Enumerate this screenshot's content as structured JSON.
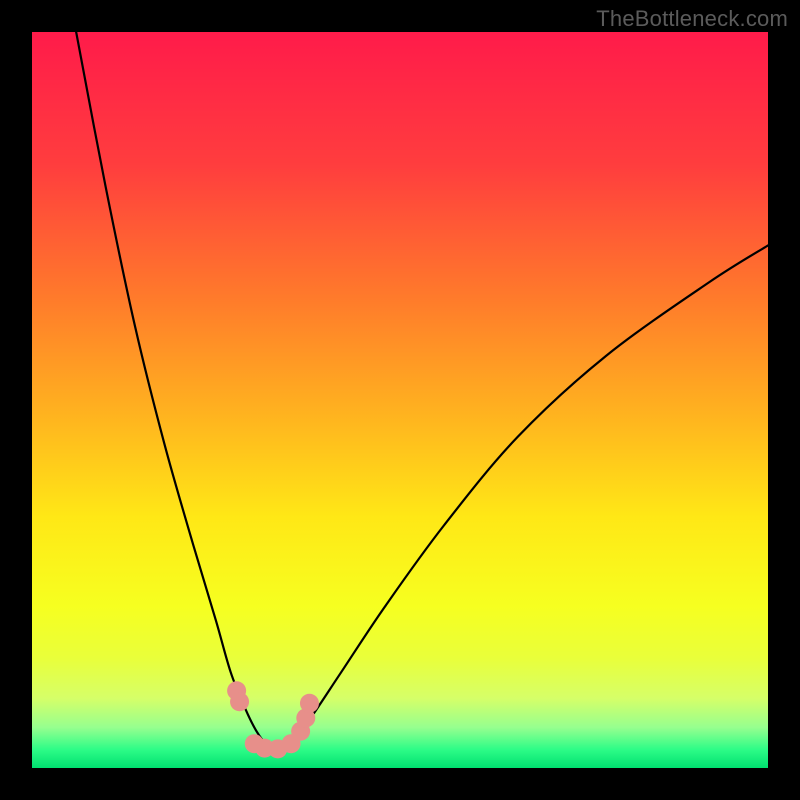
{
  "watermark": {
    "text": "TheBottleneck.com"
  },
  "chart_data": {
    "type": "line",
    "title": "",
    "xlabel": "",
    "ylabel": "",
    "xlim": [
      0,
      100
    ],
    "ylim": [
      0,
      100
    ],
    "grid": false,
    "curve": {
      "name": "bottleneck-curve",
      "description": "V-shaped bottleneck curve; minimum near x≈33% where bottleneck≈0%, rising steeply on both sides.",
      "x": [
        6,
        10,
        14,
        18,
        22,
        25,
        27,
        29,
        30.5,
        32,
        33,
        34,
        36,
        38,
        42,
        48,
        56,
        66,
        78,
        92,
        100
      ],
      "y": [
        100,
        79,
        60,
        44,
        30,
        20,
        13,
        8,
        5,
        3,
        2.5,
        3,
        4.5,
        7,
        13,
        22,
        33,
        45,
        56,
        66,
        71
      ]
    },
    "markers": {
      "name": "highlighted-points",
      "color": "#e78f8a",
      "x": [
        27.8,
        28.2,
        30.2,
        31.6,
        33.4,
        35.2,
        36.5,
        37.2,
        37.7
      ],
      "y": [
        10.5,
        9.0,
        3.3,
        2.7,
        2.6,
        3.3,
        5.0,
        6.8,
        8.8
      ]
    },
    "background_gradient": {
      "stops": [
        {
          "offset": 0.0,
          "color": "#ff1b4a"
        },
        {
          "offset": 0.18,
          "color": "#ff3d3e"
        },
        {
          "offset": 0.36,
          "color": "#ff7a2b"
        },
        {
          "offset": 0.52,
          "color": "#ffb31f"
        },
        {
          "offset": 0.66,
          "color": "#ffe816"
        },
        {
          "offset": 0.78,
          "color": "#f6ff20"
        },
        {
          "offset": 0.85,
          "color": "#e9ff3a"
        },
        {
          "offset": 0.905,
          "color": "#d6ff68"
        },
        {
          "offset": 0.945,
          "color": "#96ff8f"
        },
        {
          "offset": 0.975,
          "color": "#2dfc87"
        },
        {
          "offset": 1.0,
          "color": "#00e070"
        }
      ]
    }
  }
}
